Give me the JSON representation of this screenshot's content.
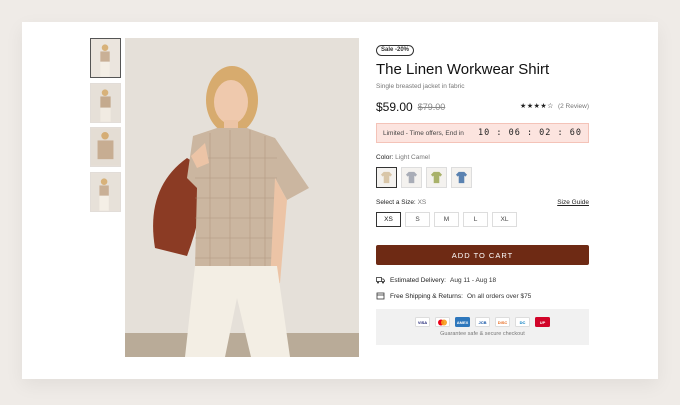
{
  "product": {
    "sale_badge": "Sale -20%",
    "title": "The Linen Workwear Shirt",
    "subtitle": "Single breasted jacket in fabric",
    "price": "$59.00",
    "old_price": "$79.00",
    "rating_stars": "★★★★☆",
    "rating_value": 4,
    "review_count": "(2 Review)"
  },
  "timer": {
    "label": "Limited - Time offers, End in",
    "value": "10 : 06 : 02 : 60"
  },
  "color": {
    "label": "Color:",
    "selected": "Light Camel",
    "swatches": [
      {
        "name": "light-camel",
        "color": "#d9c6a8"
      },
      {
        "name": "grey",
        "color": "#a9adb7"
      },
      {
        "name": "olive",
        "color": "#a9b26a"
      },
      {
        "name": "blue",
        "color": "#5a82b1"
      }
    ]
  },
  "size": {
    "label": "Select a Size:",
    "selected": "XS",
    "guide": "Size Guide",
    "options": [
      "XS",
      "S",
      "M",
      "L",
      "XL"
    ]
  },
  "cart": {
    "label": "ADD TO CART"
  },
  "delivery": {
    "label": "Estimated Delivery:",
    "value": "Aug 11 - Aug 18"
  },
  "shipping": {
    "label": "Free Shipping & Returns:",
    "value": "On all orders over $75"
  },
  "payment": {
    "cards": [
      "VISA",
      "MC",
      "AMEX",
      "JCB",
      "DISC",
      "DC",
      "UP"
    ],
    "note": "Guarantee safe & secure checkout"
  },
  "colors": {
    "accent": "#6e2a14",
    "timer_bg": "#fce4df"
  }
}
